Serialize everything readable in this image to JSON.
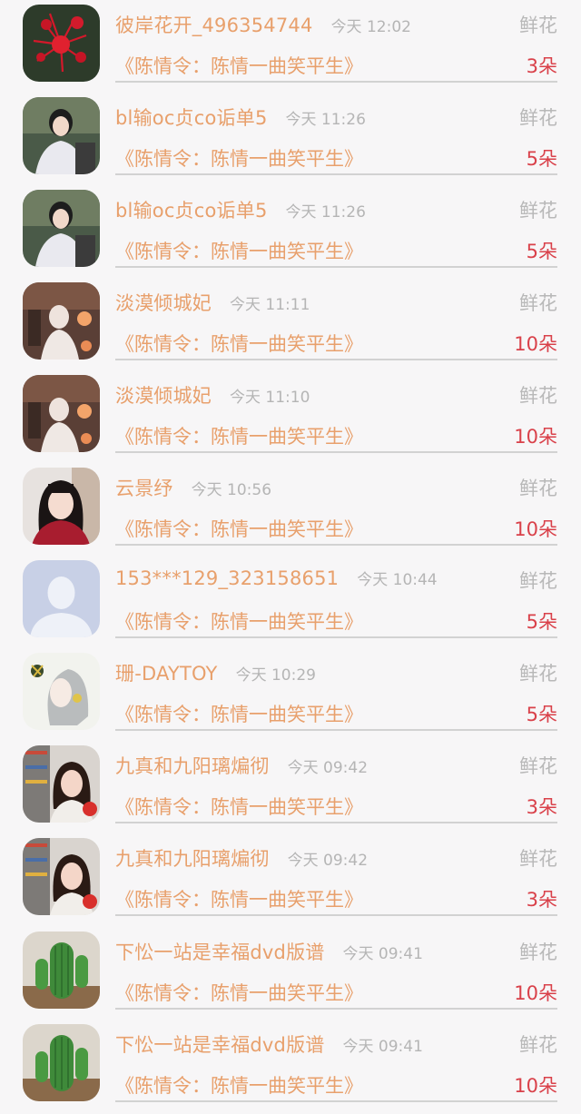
{
  "rows": [
    {
      "name": "彼岸花开_496354744",
      "time": "今天 12:02",
      "gift": "鲜花",
      "book": "《陈情令：陈情一曲笑平生》",
      "count": "3朵",
      "avatar_icon": "red-flower-icon"
    },
    {
      "name": "bl输oc贞co诟单5",
      "time": "今天 11:26",
      "gift": "鲜花",
      "book": "《陈情令：陈情一曲笑平生》",
      "count": "5朵",
      "avatar_icon": "girl-portrait-icon"
    },
    {
      "name": "bl输oc贞co诟单5",
      "time": "今天 11:26",
      "gift": "鲜花",
      "book": "《陈情令：陈情一曲笑平生》",
      "count": "5朵",
      "avatar_icon": "girl-portrait-icon"
    },
    {
      "name": "淡漠倾城妃",
      "time": "今天 11:11",
      "gift": "鲜花",
      "book": "《陈情令：陈情一曲笑平生》",
      "count": "10朵",
      "avatar_icon": "costume-figure-icon"
    },
    {
      "name": "淡漠倾城妃",
      "time": "今天 11:10",
      "gift": "鲜花",
      "book": "《陈情令：陈情一曲笑平生》",
      "count": "10朵",
      "avatar_icon": "costume-figure-icon"
    },
    {
      "name": "云景纾",
      "time": "今天 10:56",
      "gift": "鲜花",
      "book": "《陈情令：陈情一曲笑平生》",
      "count": "10朵",
      "avatar_icon": "girl-portrait-icon"
    },
    {
      "name": "153***129_323158651",
      "time": "今天 10:44",
      "gift": "鲜花",
      "book": "《陈情令：陈情一曲笑平生》",
      "count": "5朵",
      "avatar_icon": "default-user-icon"
    },
    {
      "name": "珊-DAYTOY",
      "time": "今天 10:29",
      "gift": "鲜花",
      "book": "《陈情令：陈情一曲笑平生》",
      "count": "5朵",
      "avatar_icon": "anime-girl-icon"
    },
    {
      "name": "九真和九阳璃煸彻",
      "time": "今天 09:42",
      "gift": "鲜花",
      "book": "《陈情令：陈情一曲笑平生》",
      "count": "3朵",
      "avatar_icon": "girl-portrait-icon"
    },
    {
      "name": "九真和九阳璃煸彻",
      "time": "今天 09:42",
      "gift": "鲜花",
      "book": "《陈情令：陈情一曲笑平生》",
      "count": "3朵",
      "avatar_icon": "girl-portrait-icon"
    },
    {
      "name": "下忪一站是幸福dvd版谱",
      "time": "今天 09:41",
      "gift": "鲜花",
      "book": "《陈情令：陈情一曲笑平生》",
      "count": "10朵",
      "avatar_icon": "cactus-icon"
    },
    {
      "name": "下忪一站是幸福dvd版谱",
      "time": "今天 09:41",
      "gift": "鲜花",
      "book": "《陈情令：陈情一曲笑平生》",
      "count": "10朵",
      "avatar_icon": "cactus-icon"
    }
  ],
  "colors": {
    "name": "#e8a06c",
    "time": "#b5b5b5",
    "count": "#d9414a",
    "background": "#f7f6f7"
  }
}
